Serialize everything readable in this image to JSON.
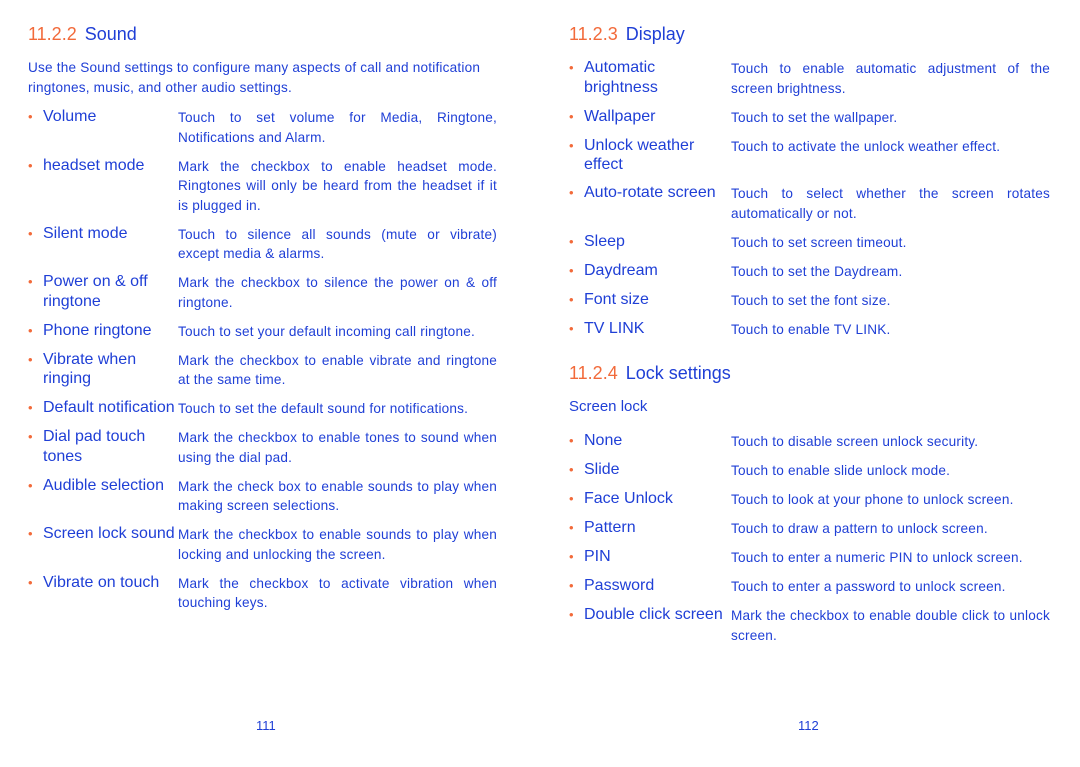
{
  "sound": {
    "number": "11.2.2",
    "title": "Sound",
    "intro": "Use the Sound settings to configure many aspects of call and notification ringtones, music, and other audio settings.",
    "items": [
      {
        "term": "Volume",
        "desc": "Touch to set volume for Media, Ringtone, Notifications and Alarm."
      },
      {
        "term": "headset mode",
        "desc": "Mark the checkbox to enable headset mode. Ringtones will only be heard from the headset if it is plugged in."
      },
      {
        "term": "Silent mode",
        "desc": "Touch to silence all sounds (mute or vibrate) except media & alarms."
      },
      {
        "term": "Power on & off ringtone",
        "desc": "Mark the checkbox to silence the power on & off ringtone."
      },
      {
        "term": "Phone ringtone",
        "desc": "Touch to set your default incoming call ringtone."
      },
      {
        "term": "Vibrate when ringing",
        "desc": "Mark the checkbox to enable vibrate and ringtone at the same time."
      },
      {
        "term": "Default notification",
        "desc": "Touch to set the default sound for notifications."
      },
      {
        "term": "Dial pad touch tones",
        "desc": "Mark the checkbox to enable tones to sound when using the dial pad."
      },
      {
        "term": "Audible selection",
        "desc": "Mark the check box to enable sounds to play when making screen selections."
      },
      {
        "term": "Screen lock sound",
        "desc": "Mark the checkbox to enable sounds to play when locking and unlocking the screen."
      },
      {
        "term": "Vibrate on touch",
        "desc": "Mark the checkbox to activate vibration when touching keys."
      }
    ]
  },
  "display": {
    "number": "11.2.3",
    "title": "Display",
    "items": [
      {
        "term": "Automatic brightness",
        "desc": "Touch to enable automatic adjustment of the screen brightness."
      },
      {
        "term": "Wallpaper",
        "desc": "Touch to set the wallpaper."
      },
      {
        "term": "Unlock weather effect",
        "desc": "Touch to activate the unlock weather effect."
      },
      {
        "term": "Auto-rotate screen",
        "desc": "Touch to select whether the screen rotates automatically or not."
      },
      {
        "term": "Sleep",
        "desc": "Touch to set screen timeout."
      },
      {
        "term": "Daydream",
        "desc": "Touch to set the Daydream."
      },
      {
        "term": "Font size",
        "desc": "Touch to set the font size."
      },
      {
        "term": "TV LINK",
        "desc": "Touch to enable TV LINK."
      }
    ]
  },
  "lock": {
    "number": "11.2.4",
    "title": "Lock settings",
    "subtitle": "Screen lock",
    "items": [
      {
        "term": "None",
        "desc": "Touch to disable screen unlock security."
      },
      {
        "term": "Slide",
        "desc": "Touch to enable slide unlock mode."
      },
      {
        "term": "Face Unlock",
        "desc": "Touch to look at your phone to unlock screen."
      },
      {
        "term": "Pattern",
        "desc": "Touch to draw a pattern to unlock screen."
      },
      {
        "term": "PIN",
        "desc": "Touch to enter a numeric PIN to unlock screen."
      },
      {
        "term": "Password",
        "desc": "Touch to enter a password to unlock screen."
      },
      {
        "term": "Double click screen",
        "desc": "Mark the checkbox to enable double click to unlock screen."
      }
    ]
  },
  "page_numbers": {
    "left": "111",
    "right": "112"
  },
  "colors": {
    "heading_number": "#f26a3a",
    "text": "#1f3fd6"
  }
}
